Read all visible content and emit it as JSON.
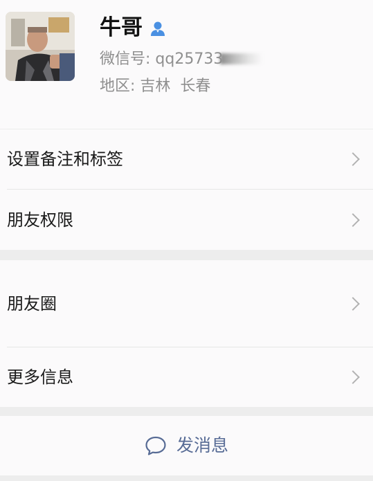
{
  "profile": {
    "name": "牛哥",
    "wechat_id_label": "微信号:",
    "wechat_id_value": "qq25733",
    "region_label": "地区:",
    "region_value": "吉林  长春"
  },
  "menu": {
    "set_remark_and_tags": "设置备注和标签",
    "friend_permissions": "朋友权限",
    "moments": "朋友圈",
    "more_info": "更多信息"
  },
  "action": {
    "send_message": "发消息"
  },
  "colors": {
    "link_blue": "#576b95",
    "contact_icon_blue": "#4a90e2",
    "secondary_text": "#8f8f8f"
  }
}
